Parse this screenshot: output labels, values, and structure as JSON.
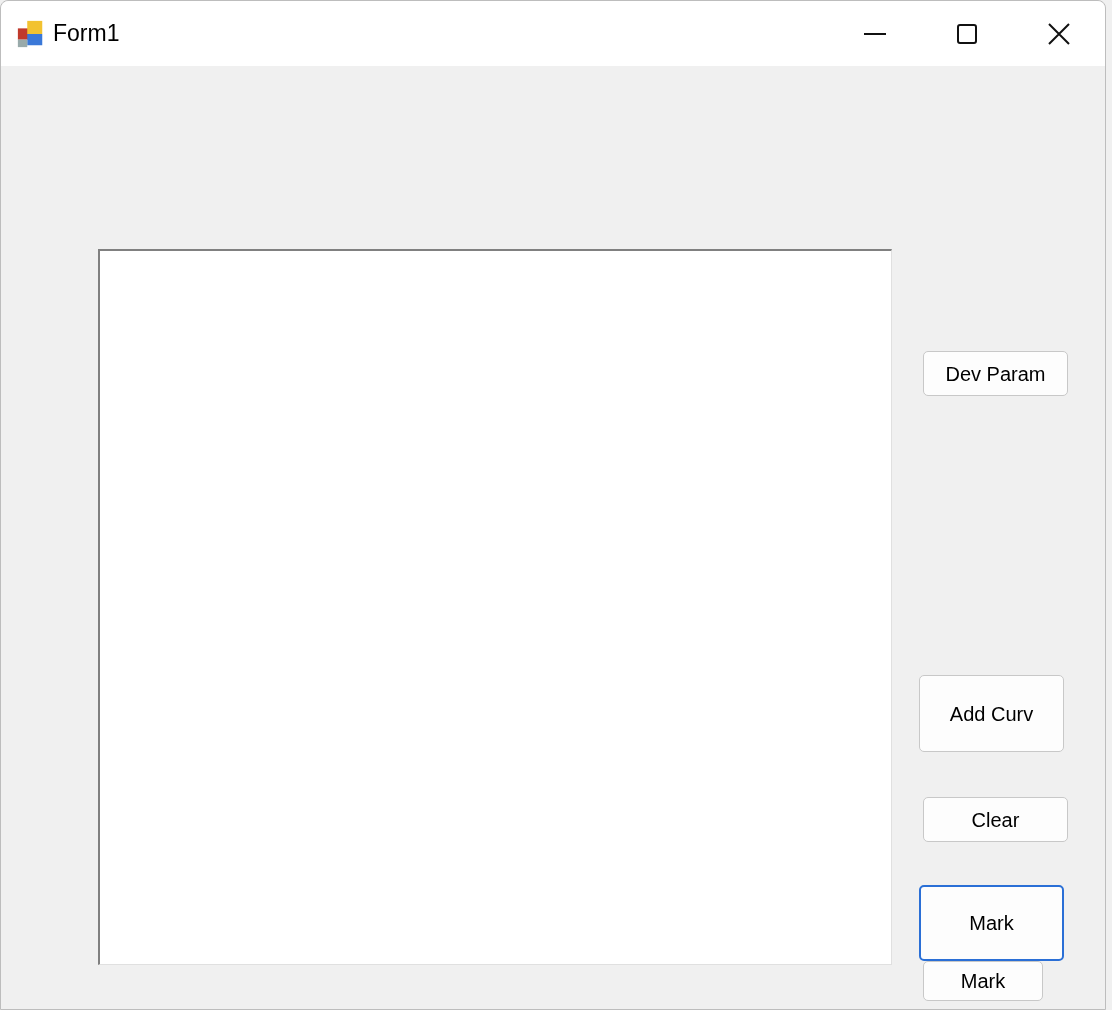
{
  "window": {
    "title": "Form1"
  },
  "buttons": [
    {
      "label": "Dev Param",
      "focused": false
    },
    {
      "label": "Add Curv",
      "focused": false
    },
    {
      "label": "Clear",
      "focused": false
    },
    {
      "label": "Mark",
      "focused": true
    },
    {
      "label": "Mark",
      "focused": false
    }
  ]
}
